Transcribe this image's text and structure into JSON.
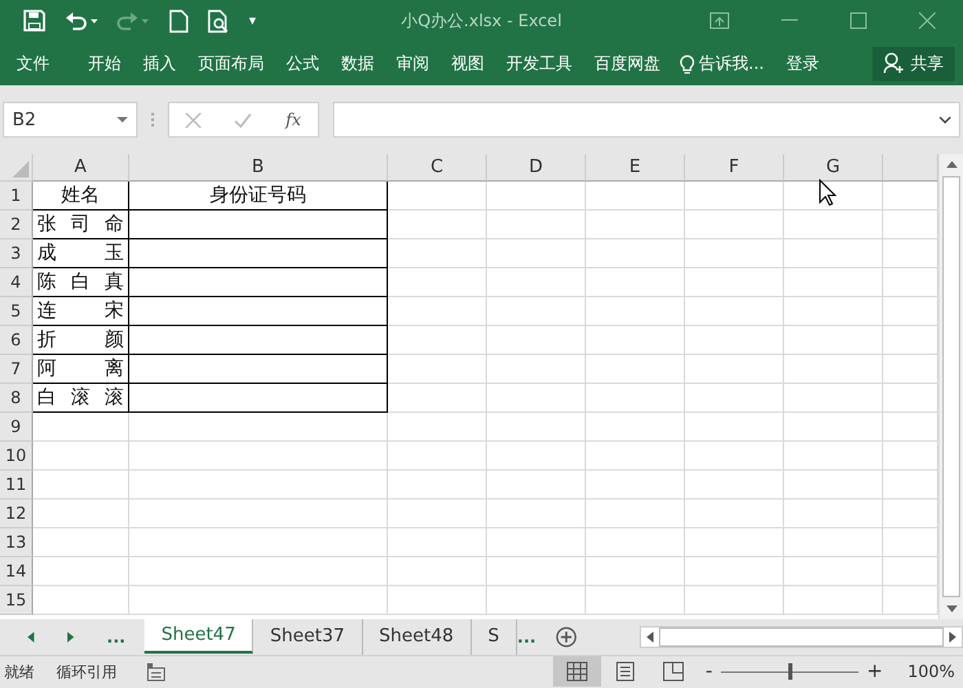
{
  "window": {
    "title": "小Q办公.xlsx - Excel"
  },
  "quick_access": {
    "more": "▾"
  },
  "ribbon_tabs": [
    {
      "label": "文件"
    },
    {
      "label": "开始"
    },
    {
      "label": "插入"
    },
    {
      "label": "页面布局"
    },
    {
      "label": "公式"
    },
    {
      "label": "数据"
    },
    {
      "label": "审阅"
    },
    {
      "label": "视图"
    },
    {
      "label": "开发工具"
    },
    {
      "label": "百度网盘"
    }
  ],
  "tell_me": "告诉我...",
  "sign_in": "登录",
  "share": "共享",
  "formula_bar": {
    "name_box": "B2",
    "fx": "fx"
  },
  "columns": [
    "A",
    "B",
    "C",
    "D",
    "E",
    "F",
    "G"
  ],
  "rows": [
    {
      "header": "1",
      "cells": [
        "姓名",
        "身份证号码"
      ]
    },
    {
      "header": "2",
      "cells": [
        "张 司 命"
      ]
    },
    {
      "header": "3",
      "cells": [
        "成　　玉"
      ]
    },
    {
      "header": "4",
      "cells": [
        "陈 白 真"
      ]
    },
    {
      "header": "5",
      "cells": [
        "连　　宋"
      ]
    },
    {
      "header": "6",
      "cells": [
        "折　　颜"
      ]
    },
    {
      "header": "7",
      "cells": [
        "阿　　离"
      ]
    },
    {
      "header": "8",
      "cells": [
        "白 滚 滚"
      ]
    },
    {
      "header": "9"
    },
    {
      "header": "10"
    },
    {
      "header": "11"
    },
    {
      "header": "12"
    },
    {
      "header": "13"
    },
    {
      "header": "14"
    },
    {
      "header": "15"
    }
  ],
  "sheet_tabs": [
    {
      "label": "Sheet47",
      "selected": true
    },
    {
      "label": "Sheet37",
      "selected": false
    },
    {
      "label": "Sheet48",
      "selected": false
    },
    {
      "label": "S",
      "selected": false
    }
  ],
  "sheet_more": "...",
  "sheet_nav_more": "...",
  "status_bar": {
    "ready": "就绪",
    "circular": "循环引用",
    "zoom": {
      "level": 0.5,
      "reading": "100%"
    },
    "views": [
      {
        "kind": "normal",
        "selected": true
      },
      {
        "kind": "layout",
        "selected": false
      },
      {
        "kind": "break",
        "selected": false
      }
    ],
    "minus": "-",
    "plus": "+"
  }
}
